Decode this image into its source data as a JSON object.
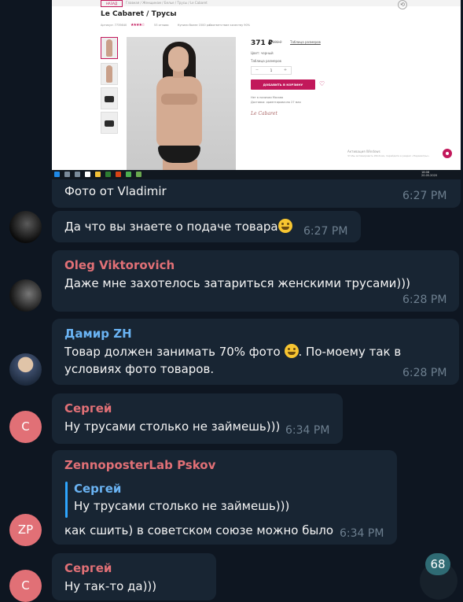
{
  "screenshot": {
    "back_label": "НАЗАД",
    "breadcrumb": "Главная  /  Женщинам  /  Белье  /  Трусы  /  Le Cabaret",
    "product_title": "Le Cabaret / Трусы",
    "article": "Артикул: 7735640",
    "rating_stars": "★★★★☆",
    "reviews": "53 отзыва",
    "bought": "Купили более 1500 раз",
    "quality": "Соответствие качеству 90%",
    "price": "371 ₽",
    "old_price": "890 ₽",
    "size_chart": "Таблица размеров",
    "color_label": "Цвет: черный",
    "size_label": "Таблица размеров",
    "qty_minus": "−",
    "qty_value": "1",
    "qty_plus": "+",
    "add_to_cart": "ДОБАВИТЬ В КОРЗИНУ",
    "availability": "Нет в наличии Москва",
    "delivery": "Доставка: ориентировочно 27 мая",
    "brand_logo": "Le Cabaret",
    "windows_activation": "Активация Windows",
    "windows_activation_sub": "Чтобы активировать Windows, перейдите в раздел «Параметры».",
    "clock_time": "18:08",
    "clock_date": "20.05.2020"
  },
  "messages": [
    {
      "text": "Фото от Vladimir",
      "time": "6:27 PM"
    },
    {
      "text": "Да что вы знаете о подаче товара",
      "time": "6:27 PM"
    },
    {
      "sender": "Oleg Viktorovich",
      "text": "Даже мне захотелось затариться женскими трусами)))",
      "time": "6:28 PM"
    },
    {
      "sender": "Дамир ZH",
      "text_line1": "Товар должен занимать 70% фото",
      "text_line1b": ". По-моему так в",
      "text_line2": "условиях фото товаров.",
      "time": "6:28 PM"
    },
    {
      "sender": "Сергей",
      "text": "Ну трусами столько не займешь)))",
      "time": "6:34 PM",
      "avatar": "С"
    },
    {
      "sender": "ZennoposterLab Pskov",
      "quote_sender": "Сергей",
      "quote_text": "Ну трусами столько не займешь)))",
      "text": "как сшить) в советском союзе можно было",
      "time": "6:34 PM",
      "avatar": "ZP"
    },
    {
      "sender": "Сергей",
      "text": "Ну так-то да)))",
      "avatar": "С"
    }
  ],
  "unread_badge": "68",
  "colors": {
    "background": "#0e1621",
    "bubble": "#182533",
    "sender_pink": "#e17076",
    "sender_blue": "#6ab3f3",
    "quote_accent": "#2ea6ff",
    "timestamp": "#6d7f8f",
    "brand_magenta": "#c2185b"
  }
}
